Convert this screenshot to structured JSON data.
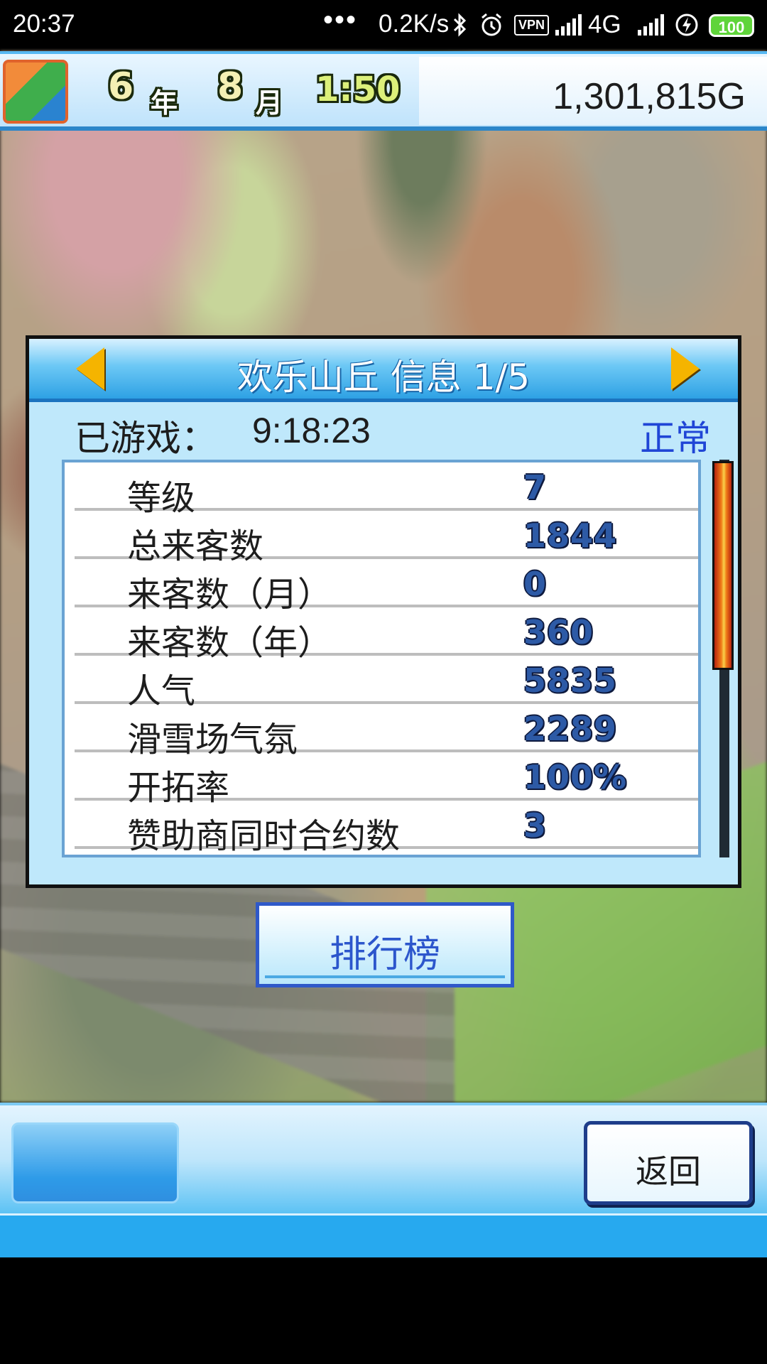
{
  "status_bar": {
    "time": "20:37",
    "dots": "•••",
    "network_speed": "0.2K/s",
    "vpn": "VPN",
    "signal": "4G",
    "battery": "100"
  },
  "hud": {
    "year": "6",
    "year_unit": "年",
    "month": "8",
    "month_unit": "月",
    "clock": "1:50",
    "money": "1,301,815G"
  },
  "dialog": {
    "title": "欢乐山丘 信息 1/5",
    "played_label": "已游戏：",
    "played_time": "9:18:23",
    "status": "正常",
    "stats": [
      {
        "label": "等级",
        "value": "7"
      },
      {
        "label": "总来客数",
        "value": "1844"
      },
      {
        "label": "来客数（月）",
        "value": "0"
      },
      {
        "label": "来客数（年）",
        "value": "360"
      },
      {
        "label": "人气",
        "value": "5835"
      },
      {
        "label": "滑雪场气氛",
        "value": "2289"
      },
      {
        "label": "开拓率",
        "value": "100%"
      },
      {
        "label": "赞助商同时合约数",
        "value": "3"
      }
    ]
  },
  "ranking_button": "排行榜",
  "back_button": "返回",
  "colors": {
    "accent_blue": "#2ea1e4",
    "status_blue": "#1f45d6",
    "arrow_yellow": "#f5b400"
  }
}
